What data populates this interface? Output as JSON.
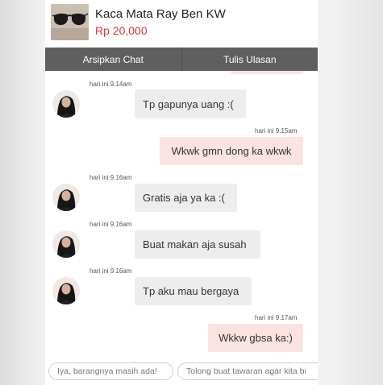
{
  "product": {
    "title": "Kaca Mata Ray Ben KW",
    "price": "Rp 20,000"
  },
  "actions": {
    "archive_label": "Arsipkan Chat",
    "review_label": "Tulis Ulasan"
  },
  "messages": [
    {
      "time": "hari ini 9.14am",
      "text": "Tp gapunya uang :(",
      "from": "seller"
    },
    {
      "time": "hari ini 9.15am",
      "text": "Wkwk gmn dong ka wkwk",
      "from": "buyer"
    },
    {
      "time": "hari ini 9.16am",
      "text": "Gratis aja ya ka :(",
      "from": "seller"
    },
    {
      "time": "hari ini 9.16am",
      "text": "Buat makan aja susah",
      "from": "seller"
    },
    {
      "time": "hari ini 9.16am",
      "text": "Tp aku mau bergaya",
      "from": "seller"
    },
    {
      "time": "hari ini 9.17am",
      "text": "Wkkw gbsa ka:)",
      "from": "buyer"
    }
  ],
  "quick_replies": [
    "Iya, barangnya masih ada!",
    "Tolong buat tawaran agar kita bi"
  ],
  "colors": {
    "price": "#d6343a",
    "action_bar": "#5f5f5f",
    "outgoing_bubble": "#fbe3e4",
    "incoming_bubble": "#ededed"
  }
}
